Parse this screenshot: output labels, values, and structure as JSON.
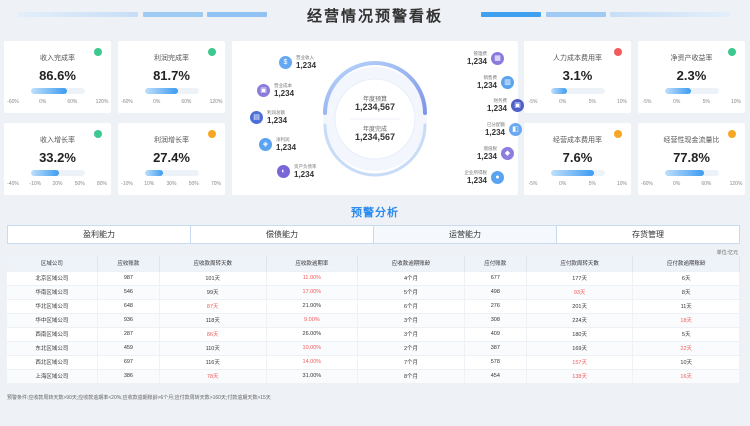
{
  "title": "经营情况预警看板",
  "kpis": [
    {
      "label": "收入完成率",
      "value": "86.6%",
      "status_color": "#3cc88e",
      "progress": 0.66,
      "ticks": [
        "-60%",
        "0%",
        "60%",
        "120%"
      ]
    },
    {
      "label": "利润完成率",
      "value": "81.7%",
      "status_color": "#3cc88e",
      "progress": 0.61,
      "ticks": [
        "-60%",
        "0%",
        "60%",
        "120%"
      ]
    },
    {
      "label": "人力成本费用率",
      "value": "3.1%",
      "status_color": "#f35b5b",
      "progress": 0.3,
      "ticks": [
        "-5%",
        "0%",
        "5%",
        "10%"
      ]
    },
    {
      "label": "净资产收益率",
      "value": "2.3%",
      "status_color": "#3cc88e",
      "progress": 0.48,
      "ticks": [
        "-5%",
        "0%",
        "5%",
        "10%"
      ]
    },
    {
      "label": "收入增长率",
      "value": "33.2%",
      "status_color": "#3cc88e",
      "progress": 0.52,
      "ticks": [
        "-40%",
        "-10%",
        "20%",
        "50%",
        "80%"
      ]
    },
    {
      "label": "利润增长率",
      "value": "27.4%",
      "status_color": "#f6a623",
      "progress": 0.34,
      "ticks": [
        "-10%",
        "10%",
        "30%",
        "50%",
        "70%"
      ]
    },
    {
      "label": "经营成本费用率",
      "value": "7.6%",
      "status_color": "#f6a623",
      "progress": 0.8,
      "ticks": [
        "-5%",
        "0%",
        "5%",
        "10%"
      ]
    },
    {
      "label": "经营性现金流量比",
      "value": "77.8%",
      "status_color": "#f6a623",
      "progress": 0.73,
      "ticks": [
        "-60%",
        "0%",
        "60%",
        "120%"
      ]
    }
  ],
  "center": {
    "annual_budget_label": "年度预算",
    "annual_budget_value": "1,234,567",
    "annual_done_label": "年度完成",
    "annual_done_value": "1,234,567",
    "left_items": [
      {
        "name": "营业收入",
        "value": "1,234",
        "color": "#64a8f2",
        "icon": "$"
      },
      {
        "name": "营业成本",
        "value": "1,234",
        "color": "#8a7bdc",
        "icon": "▣"
      },
      {
        "name": "利润总额",
        "value": "1,234",
        "color": "#4e6fd8",
        "icon": "▤"
      },
      {
        "name": "净利润",
        "value": "1,234",
        "color": "#5aa3f0",
        "icon": "◈"
      },
      {
        "name": "资产负债率",
        "value": "1,234",
        "color": "#7b66d8",
        "icon": "◐"
      }
    ],
    "right_items": [
      {
        "name": "管理费",
        "value": "1,234",
        "color": "#8c79de",
        "icon": "▦"
      },
      {
        "name": "销售费",
        "value": "1,234",
        "color": "#5aa3f0",
        "icon": "▥"
      },
      {
        "name": "财务费",
        "value": "1,234",
        "color": "#4e5fc8",
        "icon": "▣"
      },
      {
        "name": "已分配额",
        "value": "1,234",
        "color": "#6aa9f0",
        "icon": "◧"
      },
      {
        "name": "增值税",
        "value": "1,234",
        "color": "#8c7ede",
        "icon": "◆"
      },
      {
        "name": "企业所得税",
        "value": "1,234",
        "color": "#5aa3f0",
        "icon": "●"
      }
    ]
  },
  "section_title": "预警分析",
  "tabs": [
    "盈利能力",
    "偿债能力",
    "运营能力",
    "存货管理"
  ],
  "unit": "单位:亿元",
  "table": {
    "headers": [
      "区域公司",
      "应收账款",
      "应收款周转天数",
      "应收款逾期率",
      "应收款逾期账龄",
      "应付账款",
      "应付款周转天数",
      "应付款逾期账龄"
    ],
    "rows": [
      [
        "北京区域公司",
        "987",
        "101天",
        "11.00%",
        "4个月",
        "677",
        "177天",
        "6天"
      ],
      [
        "华南区域公司",
        "546",
        "99天",
        "17.00%",
        "5个月",
        "498",
        "93天",
        "8天"
      ],
      [
        "华北区域公司",
        "648",
        "87天",
        "21.00%",
        "6个月",
        "276",
        "201天",
        "11天"
      ],
      [
        "华中区域公司",
        "936",
        "118天",
        "9.00%",
        "3个月",
        "308",
        "224天",
        "18天"
      ],
      [
        "西南区域公司",
        "287",
        "86天",
        "26.00%",
        "3个月",
        "409",
        "180天",
        "5天"
      ],
      [
        "东北区域公司",
        "459",
        "110天",
        "10.00%",
        "2个月",
        "387",
        "169天",
        "22天"
      ],
      [
        "西北区域公司",
        "697",
        "116天",
        "14.00%",
        "7个月",
        "578",
        "157天",
        "10天"
      ],
      [
        "上海区域公司",
        "386",
        "78天",
        "31.00%",
        "8个月",
        "454",
        "138天",
        "16天"
      ]
    ],
    "red_cells": [
      [
        0,
        3
      ],
      [
        1,
        3
      ],
      [
        1,
        6
      ],
      [
        2,
        2
      ],
      [
        3,
        3
      ],
      [
        3,
        7
      ],
      [
        4,
        2
      ],
      [
        5,
        3
      ],
      [
        5,
        7
      ],
      [
        6,
        3
      ],
      [
        6,
        6
      ],
      [
        7,
        2
      ],
      [
        7,
        6
      ],
      [
        7,
        7
      ]
    ]
  },
  "footnote": "预警条件:应收款周转天数>90天;应收款逾期率<20%;应收款逾期账龄>6个月;应付款周转天数>160天;付款逾期天数>15天"
}
